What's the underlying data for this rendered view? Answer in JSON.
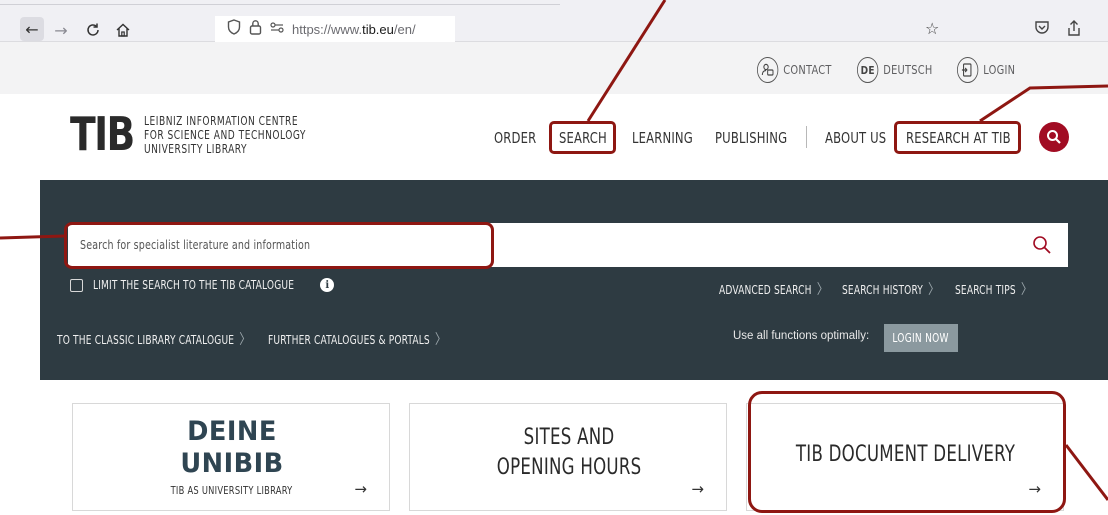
{
  "browser": {
    "url_prefix": "https://www.",
    "url_domain": "tib.eu",
    "url_path": "/en/",
    "icons": [
      "back-icon",
      "forward-icon",
      "reload-icon",
      "home-icon",
      "shield-icon",
      "lock-icon",
      "permissions-icon",
      "bookmark-star-icon",
      "pocket-icon",
      "share-icon"
    ]
  },
  "utility": {
    "contact": "CONTACT",
    "language_code": "DE",
    "language": "DEUTSCH",
    "login": "LOGIN"
  },
  "header": {
    "logo_mark": "TIB",
    "logo_lines": [
      "LEIBNIZ INFORMATION CENTRE",
      "FOR SCIENCE AND TECHNOLOGY",
      "UNIVERSITY LIBRARY"
    ],
    "nav": {
      "order": "ORDER",
      "search": "SEARCH",
      "learning": "LEARNING",
      "publishing": "PUBLISHING",
      "about": "ABOUT US",
      "research": "RESEARCH AT TIB"
    }
  },
  "search": {
    "placeholder": "Search for specialist literature and information",
    "limit_label": "LIMIT THE SEARCH TO THE TIB CATALOGUE",
    "advanced": "ADVANCED SEARCH",
    "history": "SEARCH HISTORY",
    "tips": "SEARCH TIPS",
    "classic_catalogue": "TO THE CLASSIC LIBRARY CATALOGUE",
    "further_catalogues": "FURTHER CATALOGUES & PORTALS",
    "use_all": "Use all functions optimally:",
    "login_now": "LOGIN NOW"
  },
  "tiles": {
    "unibib": {
      "line1": "DEINE",
      "line2": "UNIBIB",
      "subtitle": "TIB AS UNIVERSITY LIBRARY"
    },
    "sites": {
      "line1": "SITES AND",
      "line2": "OPENING HOURS"
    },
    "delivery": {
      "title": "TIB DOCUMENT DELIVERY"
    },
    "arrow": "→"
  },
  "colors": {
    "accent": "#a10c23",
    "band": "#2e3b42",
    "annotation": "#8e1712",
    "login_button": "#8b999f"
  }
}
